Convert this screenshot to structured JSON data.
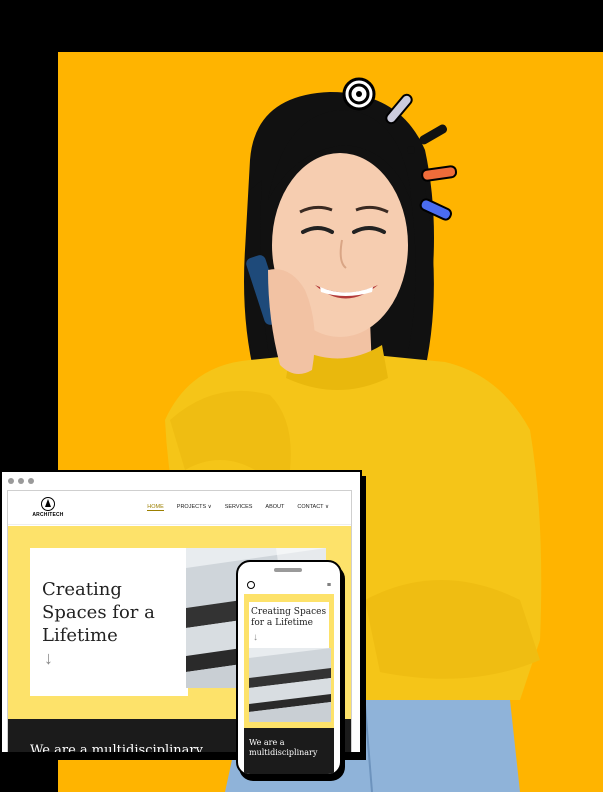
{
  "colors": {
    "panel": "#ffb400",
    "hero_bg": "#fde26a",
    "sweater": "#f5c518",
    "dark": "#1b1b1b"
  },
  "desktop_site": {
    "brand": "ARCHITECH",
    "nav": [
      "HOME",
      "PROJECTS ∨",
      "SERVICES",
      "ABOUT",
      "CONTACT ∨"
    ],
    "hero_title": "Creating Spaces for a Lifetime",
    "arrow": "↓",
    "band_text": "We are a multidisciplinary"
  },
  "mobile_site": {
    "menu_icon": "≡",
    "hero_title": "Creating Spaces for a Lifetime",
    "arrow": "↓",
    "band_text": "We are a multidisciplinary"
  }
}
